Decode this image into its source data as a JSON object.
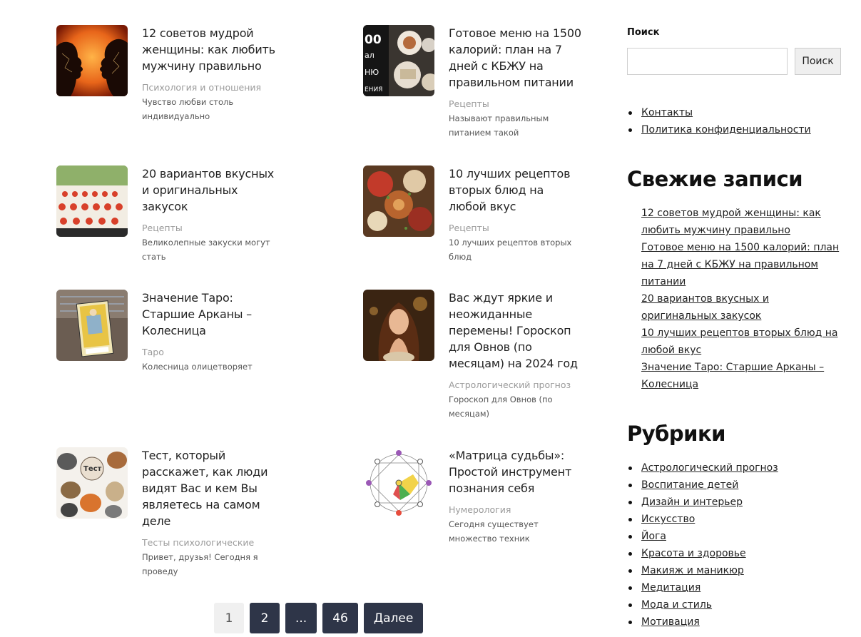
{
  "posts": [
    {
      "title": "12 советов мудрой женщины: как любить мужчину правильно",
      "category": "Психология и отношения",
      "excerpt": "Чувство любви столь индивидуально",
      "thumb": "couple-silhouette-image"
    },
    {
      "title": "Готовое меню на 1500 калорий: план на 7 дней с КБЖУ на правильном питании",
      "category": "Рецепты",
      "excerpt": "Называют правильным питанием такой",
      "thumb": "diet-menu-image"
    },
    {
      "title": "20 вариантов вкусных и оригинальных закусок",
      "category": "Рецепты",
      "excerpt": "Великолепные закуски могут стать",
      "thumb": "snacks-image"
    },
    {
      "title": "10 лучших рецептов вторых блюд на любой вкус",
      "category": "Рецепты",
      "excerpt": "10 лучших рецептов вторых блюд",
      "thumb": "dishes-image"
    },
    {
      "title": "Значение Таро: Старшие Арканы – Колесница",
      "category": "Таро",
      "excerpt": "Колесница олицетворяет",
      "thumb": "tarot-card-image"
    },
    {
      "title": "Вас ждут яркие и неожиданные перемены! Гороскоп для Овнов (по месяцам) на 2024 год",
      "category": "Астрологический прогноз",
      "excerpt": "Гороскоп для Овнов (по месяцам)",
      "thumb": "woman-portrait-image"
    },
    {
      "title": "Тест, который расскажет, как люди видят Вас и кем Вы являетесь на самом деле",
      "category": "Тесты психологические",
      "excerpt": "Привет, друзья! Сегодня я проведу",
      "thumb": "animals-test-image"
    },
    {
      "title": "«Матрица судьбы»: Простой инструмент познания себя",
      "category": "Нумерология",
      "excerpt": "Сегодня существует множество техник",
      "thumb": "destiny-matrix-image"
    }
  ],
  "pagination": {
    "current": "1",
    "page2": "2",
    "dots": "...",
    "last": "46",
    "next": "Далее"
  },
  "sidebar": {
    "search_label": "Поиск",
    "search_button": "Поиск",
    "search_value": "",
    "pages": [
      "Контакты",
      "Политика конфиденциальности"
    ],
    "recent_heading": "Свежие записи",
    "recent": [
      "12 советов мудрой женщины: как любить мужчину правильно",
      "Готовое меню на 1500 калорий: план на 7 дней с КБЖУ на правильном питании",
      "20 вариантов вкусных и оригинальных закусок",
      "10 лучших рецептов вторых блюд на любой вкус",
      "Значение Таро: Старшие Арканы – Колесница"
    ],
    "categories_heading": "Рубрики",
    "categories": [
      "Астрологический прогноз",
      "Воспитание детей",
      "Дизайн и интерьер",
      "Искусство",
      "Йога",
      "Красота и здоровье",
      "Макияж и маникюр",
      "Медитация",
      "Мода и стиль",
      "Мотивация"
    ]
  },
  "colors": {
    "pager_dark": "#2e3548",
    "pager_current": "#f0f0f0",
    "category_gray": "#9a9a9a"
  }
}
